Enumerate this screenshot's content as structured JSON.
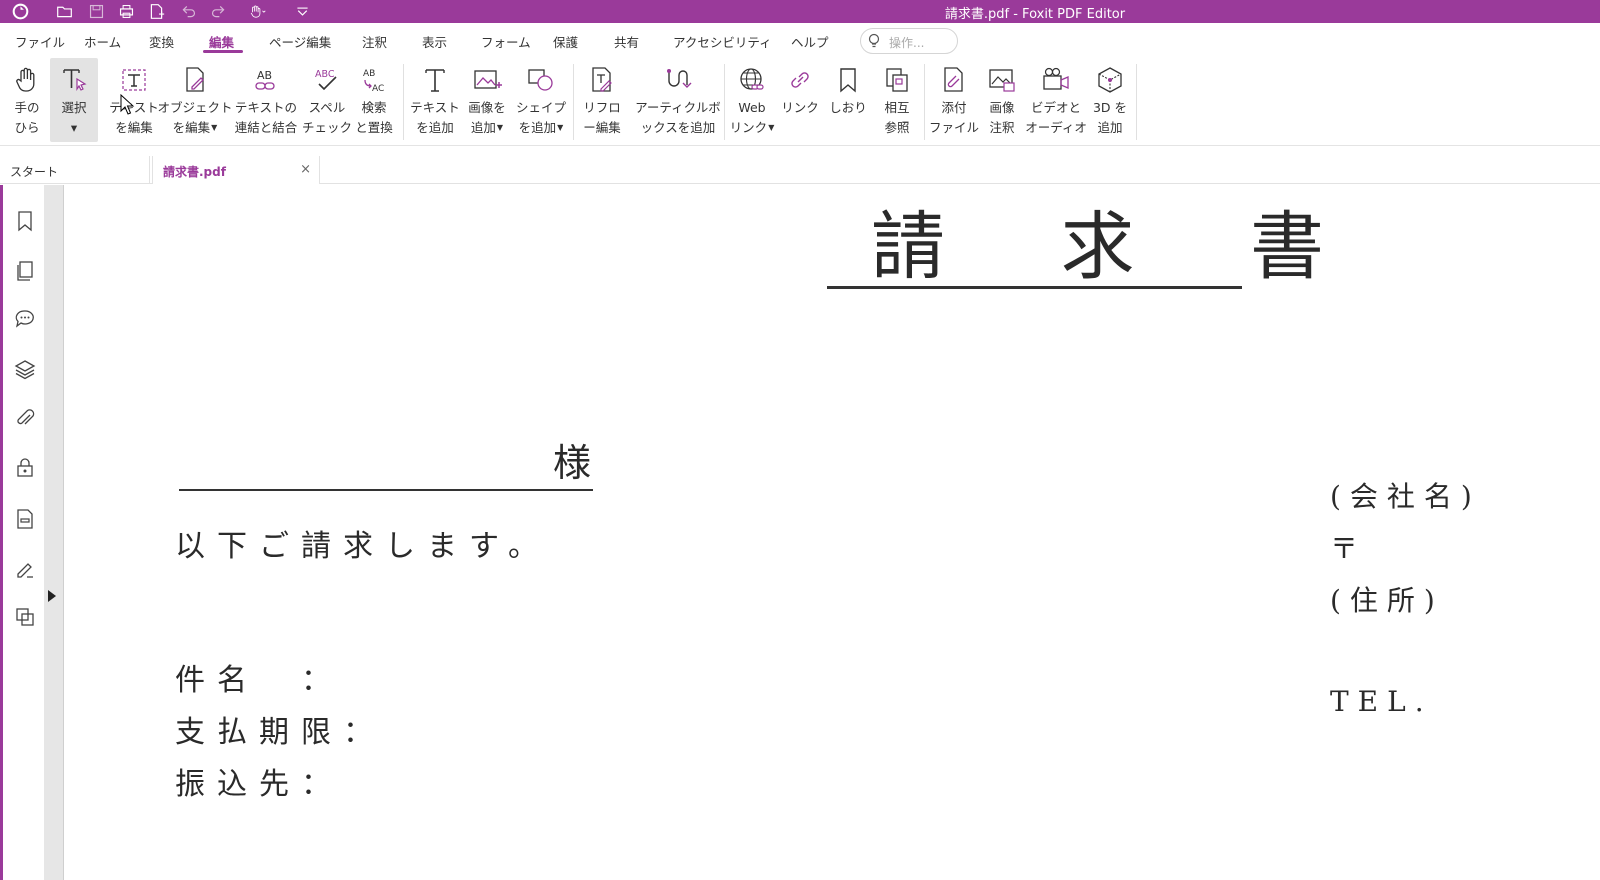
{
  "app": {
    "window_title": "請求書.pdf - Foxit PDF Editor",
    "accent_color": "#9a3a9a"
  },
  "quick_access": {
    "icons": [
      "foxit-logo-icon",
      "open-folder-icon",
      "save-icon",
      "print-icon",
      "new-doc-icon",
      "undo-icon",
      "redo-icon",
      "hand-dropdown-icon",
      "customize-icon"
    ]
  },
  "menu": {
    "items": [
      "ファイル",
      "ホーム",
      "変換",
      "編集",
      "ページ編集",
      "注釈",
      "表示",
      "フォーム",
      "保護",
      "共有",
      "アクセシビリティ",
      "ヘルプ"
    ],
    "active": "編集",
    "search_placeholder": "操作..."
  },
  "ribbon": {
    "buttons": [
      {
        "l1": "手の",
        "l2": "ひら",
        "icon": "hand-icon"
      },
      {
        "l1": "選択",
        "l2": "",
        "icon": "select-text-icon",
        "dropdown": true,
        "selected": true
      },
      {
        "l1": "テキスト",
        "l2": "を編集",
        "icon": "edit-text-icon"
      },
      {
        "l1": "オブジェクト",
        "l2": "を編集",
        "icon": "edit-object-icon",
        "dropdown": true
      },
      {
        "l1": "テキストの",
        "l2": "連結と結合",
        "icon": "link-join-text-icon"
      },
      {
        "l1": "スペル",
        "l2": "チェック",
        "icon": "spell-check-icon"
      },
      {
        "l1": "検索",
        "l2": "と置換",
        "icon": "find-replace-icon"
      },
      {
        "l1": "テキスト",
        "l2": "を追加",
        "icon": "add-text-icon"
      },
      {
        "l1": "画像を",
        "l2": "追加",
        "icon": "add-image-icon",
        "dropdown": true
      },
      {
        "l1": "シェイプ",
        "l2": "を追加",
        "icon": "add-shape-icon",
        "dropdown": true
      },
      {
        "l1": "リフロ",
        "l2": "ー編集",
        "icon": "reflow-edit-icon"
      },
      {
        "l1": "アーティクルボ",
        "l2": "ックスを追加",
        "icon": "article-box-icon"
      },
      {
        "l1": "Web",
        "l2": "リンク",
        "icon": "web-link-icon",
        "dropdown": true
      },
      {
        "l1": "リンク",
        "l2": "",
        "icon": "link-icon"
      },
      {
        "l1": "しおり",
        "l2": "",
        "icon": "bookmark-icon"
      },
      {
        "l1": "相互",
        "l2": "参照",
        "icon": "cross-reference-icon"
      },
      {
        "l1": "添付",
        "l2": "ファイル",
        "icon": "attach-file-icon"
      },
      {
        "l1": "画像",
        "l2": "注釈",
        "icon": "image-annotation-icon"
      },
      {
        "l1": "ビデオと",
        "l2": "オーディオ",
        "icon": "video-audio-icon"
      },
      {
        "l1": "3D を",
        "l2": "追加",
        "icon": "add-3d-icon"
      }
    ]
  },
  "tabs": {
    "start": "スタート",
    "doc": "請求書.pdf",
    "close": "×"
  },
  "sidebar": {
    "icons": [
      "bookmark-panel-icon",
      "pages-panel-icon",
      "comments-panel-icon",
      "layers-panel-icon",
      "attachments-panel-icon",
      "security-panel-icon",
      "fields-panel-icon",
      "signature-panel-icon",
      "compare-panel-icon"
    ]
  },
  "document": {
    "title": "請 求 書",
    "addressee_suffix": "様",
    "intro": "以下ご請求します。",
    "subject_label": "件名　：",
    "deadline_label": "支払期限：",
    "bank_label": "振込先：",
    "company": "(会社名)",
    "postal": "〒",
    "address": "(住所)",
    "tel": "TEL."
  }
}
